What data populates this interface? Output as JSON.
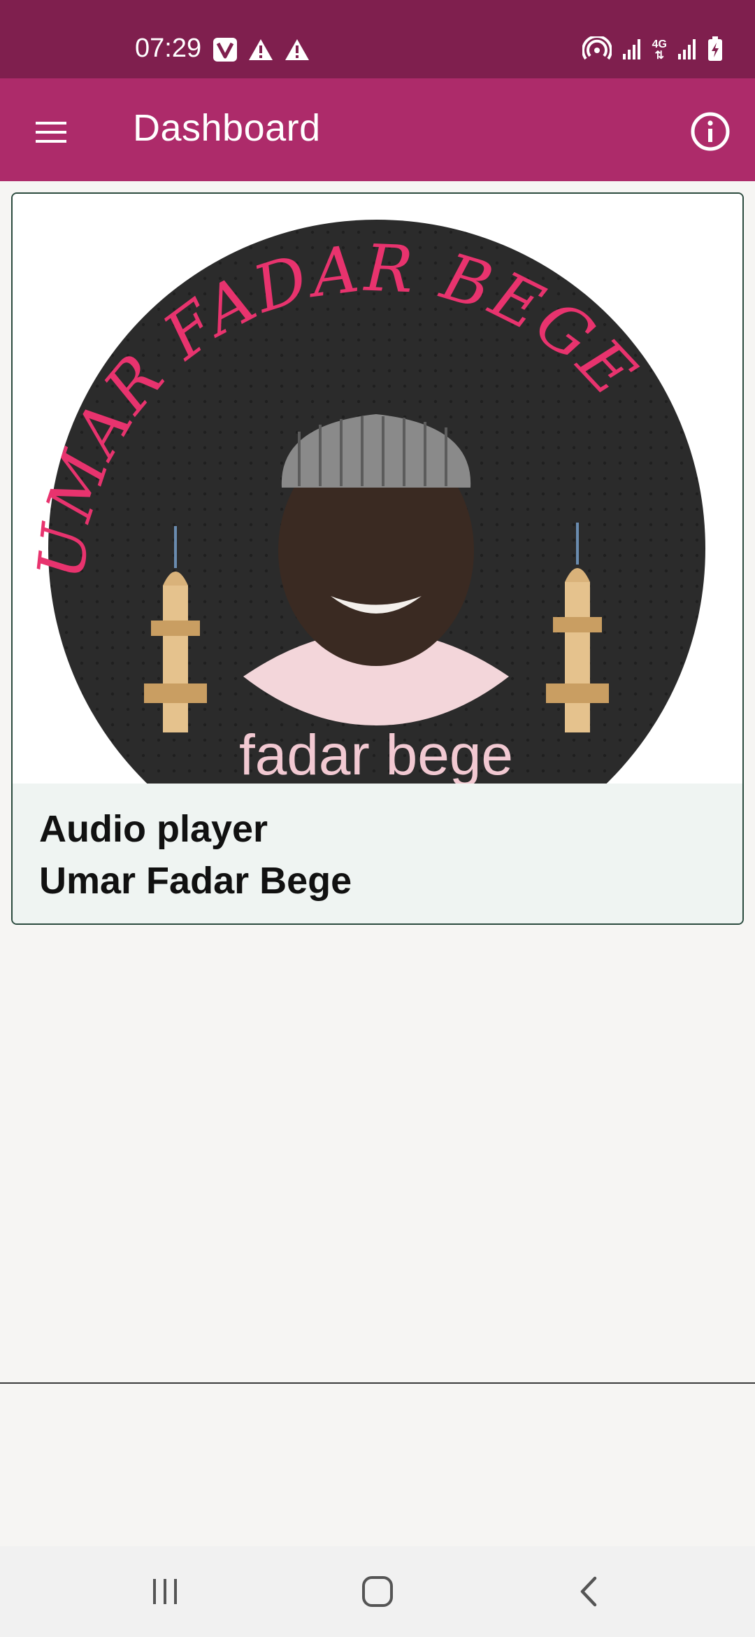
{
  "status_bar": {
    "time": "07:29",
    "left_icons": [
      "v-app-icon",
      "warning-icon",
      "warning-icon"
    ],
    "right_icons": [
      "hotspot-icon",
      "signal-icon",
      "4g-icon",
      "signal-icon",
      "battery-charging-icon"
    ],
    "network_label": "4G"
  },
  "app_bar": {
    "title": "Dashboard",
    "menu_icon": "hamburger-menu-icon",
    "info_icon": "info-icon"
  },
  "card": {
    "image": {
      "arc_text": "UMAR FADAR BEGE",
      "bottom_text": "fadar bege"
    },
    "title_line1": "Audio player",
    "title_line2": "Umar Fadar Bege"
  },
  "colors": {
    "status_bar": "#7f1f4e",
    "app_bar": "#ad2b6a",
    "card_border": "#2b4a3e",
    "card_footer": "#eff4f2",
    "arc_text": "#e8336e"
  },
  "nav_bar": {
    "recent": "recent-apps-icon",
    "home": "home-icon",
    "back": "back-icon"
  }
}
